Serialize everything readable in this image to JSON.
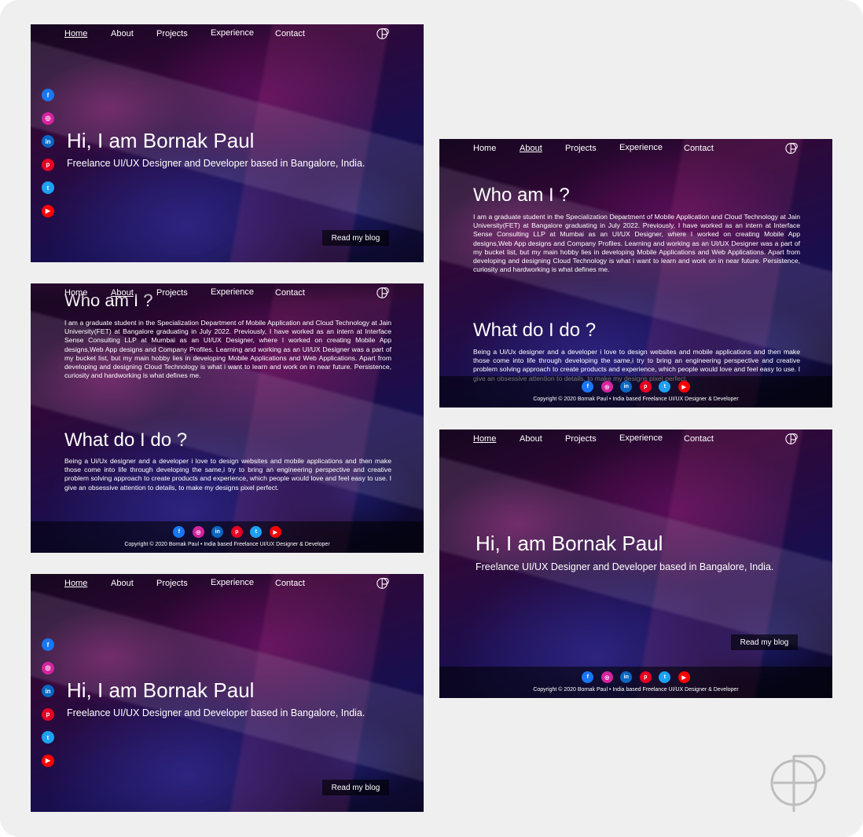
{
  "nav": {
    "items": [
      "Home",
      "About",
      "Projects",
      "Experience",
      "Contact"
    ]
  },
  "hero": {
    "title": "Hi, I am Bornak Paul",
    "subtitle": "Freelance UI/UX Designer and Developer based in Bangalore, India.",
    "blog_label": "Read my blog"
  },
  "about": {
    "who_title": "Who am I ?",
    "who_title_clipped": "Who am I ?",
    "who_text": "I am a graduate student in the Specialization Department of Mobile Application and Cloud Technology at Jain University(FET) at Bangalore graduating in July 2022. Previously, I have worked as an intern at Interface Sense Consulting LLP at Mumbai as an UI/UX Designer, where I worked on creating Mobile App designs,Web App designs and Company Profiles. Learning and working as an UI/UX Designer was a part of my bucket list, but my main hobby lies in developing Mobile Applications and Web Applications. Apart from developing and designing Cloud Technology is what i want to learn and work on in near future. Persistence, curiosity and hardworking is what defines me.",
    "what_title": "What do I do ?",
    "what_text": "Being a Ui/Ux designer and a developer i love to design websites and mobile applications and then make those come into life through developing the same,i try to bring an engineering perspective and creative problem solving approach to create products and experience, which people would love and feel easy to use. I give an obsessive attention to details, to make my designs pixel perfect."
  },
  "footer": {
    "copyright": "Copyright © 2020 Bornak Paul • India based Freelance UI/UX Designer & Developer"
  },
  "social": [
    "facebook",
    "instagram",
    "linkedin",
    "pinterest",
    "twitter",
    "youtube"
  ],
  "colors": {
    "canvas": "#efefef",
    "text": "#ffffff",
    "facebook": "#1877f2",
    "instagram": "#d6249f",
    "linkedin": "#0a66c2",
    "pinterest": "#e60023",
    "twitter": "#1da1f2",
    "youtube": "#ff0000"
  }
}
